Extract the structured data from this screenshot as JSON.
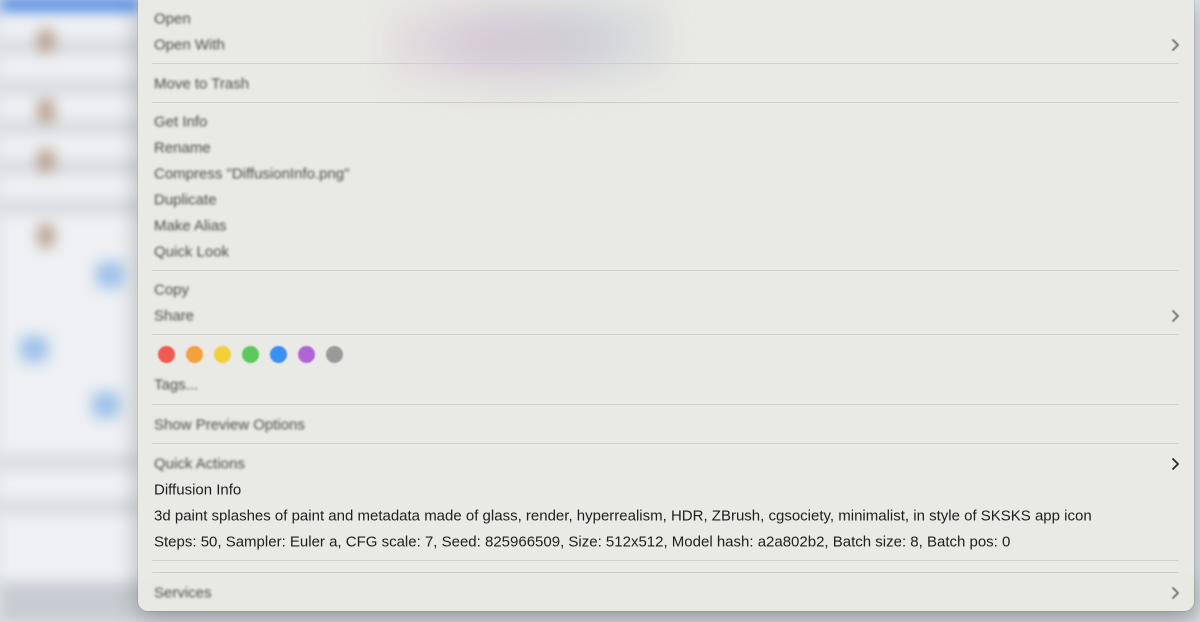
{
  "menu": {
    "items": [
      {
        "label": "Open"
      },
      {
        "label": "Open With"
      },
      {
        "label": "Move to Trash"
      },
      {
        "label": "Get Info"
      },
      {
        "label": "Rename"
      },
      {
        "label": "Compress \"DiffusionInfo.png\""
      },
      {
        "label": "Duplicate"
      },
      {
        "label": "Make Alias"
      },
      {
        "label": "Quick Look"
      },
      {
        "label": "Copy"
      },
      {
        "label": "Share"
      },
      {
        "label": "Tags..."
      },
      {
        "label": "Show Preview Options"
      },
      {
        "label": "Quick Actions"
      },
      {
        "label": "Diffusion Info"
      },
      {
        "label": "3d paint splashes of paint and metadata made of glass, render, hyperrealism, HDR, ZBrush, cgsociety, minimalist, in style of SKSKS app icon"
      },
      {
        "label": "Steps: 50, Sampler: Euler a, CFG scale: 7, Seed: 825966509, Size: 512x512, Model hash: a2a802b2, Batch size: 8, Batch pos: 0"
      },
      {
        "label": "Services"
      }
    ],
    "tag_colors": [
      {
        "name": "red",
        "color": "#f05a50"
      },
      {
        "name": "orange",
        "color": "#f5a03a"
      },
      {
        "name": "yellow",
        "color": "#f3cf3a"
      },
      {
        "name": "green",
        "color": "#5ac85a"
      },
      {
        "name": "blue",
        "color": "#3b8ef2"
      },
      {
        "name": "purple",
        "color": "#b064d6"
      },
      {
        "name": "gray",
        "color": "#9a9a9a"
      }
    ],
    "icons": {
      "submenu": "chevron-right-icon"
    }
  }
}
